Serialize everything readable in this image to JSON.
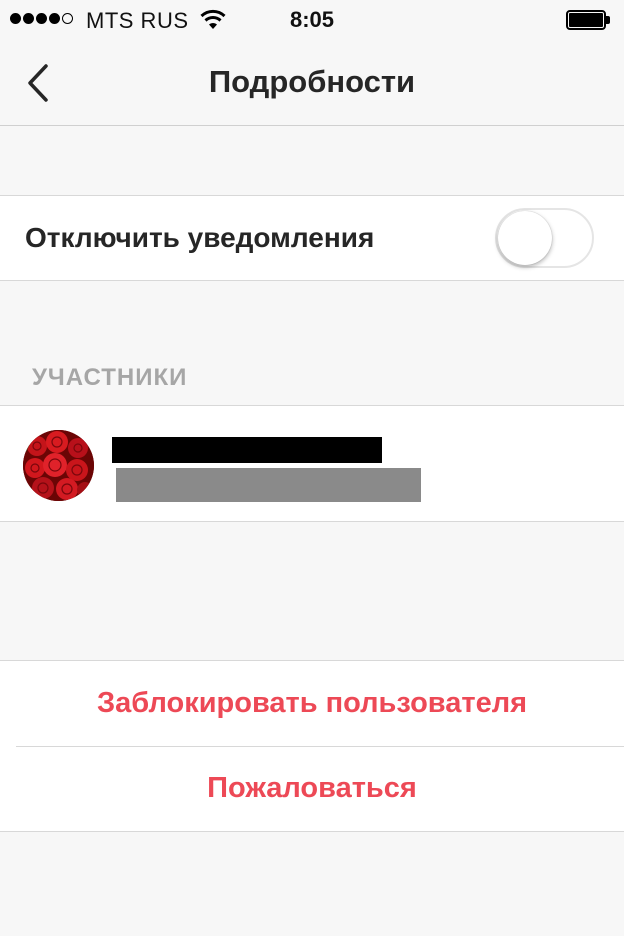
{
  "status_bar": {
    "carrier": "MTS RUS",
    "time": "8:05",
    "signal_bars_filled": 4,
    "signal_bars_total": 5,
    "wifi_icon": "wifi-icon",
    "battery_icon": "battery-icon"
  },
  "nav": {
    "title": "Подробности",
    "back_icon": "chevron-left-icon"
  },
  "notifications": {
    "label": "Отключить уведомления",
    "toggle_on": false
  },
  "participants": {
    "header": "УЧАСТНИКИ",
    "items": [
      {
        "avatar": "roses-photo",
        "name_redacted": true,
        "username_redacted": true
      }
    ]
  },
  "actions": {
    "block_label": "Заблокировать пользователя",
    "report_label": "Пожаловаться"
  },
  "colors": {
    "accent_red": "#ed4956",
    "background": "#f7f7f7",
    "section_header_gray": "#a6a6a6"
  }
}
